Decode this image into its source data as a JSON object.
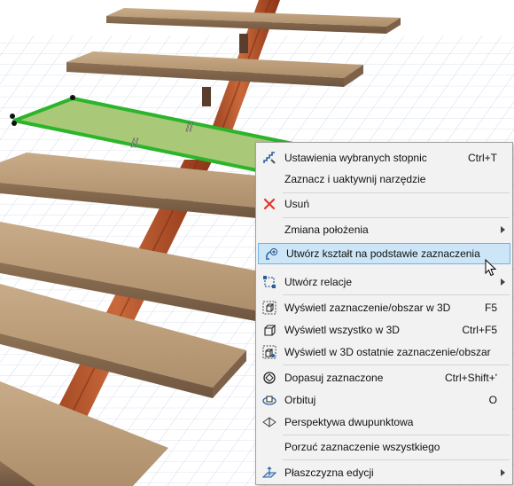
{
  "scene": {
    "description_icon": "3d-stair-scene",
    "colors": {
      "tread": "#b99a77",
      "tread_selected": "#a9c878",
      "selection_outline": "#2bb52b",
      "stringer": "#b5532a",
      "grid_line": "#c9d3e6"
    }
  },
  "context_menu": {
    "items": [
      {
        "label": "Ustawienia wybranych stopnic",
        "shortcut": "Ctrl+T",
        "icon": "stair-settings-icon"
      },
      {
        "label": "Zaznacz i uaktywnij narzędzie",
        "shortcut": "",
        "icon": ""
      },
      {
        "label": "Usuń",
        "shortcut": "",
        "icon": "delete-x-icon"
      },
      {
        "label": "Zmiana położenia",
        "shortcut": "",
        "icon": "",
        "submenu": true
      },
      {
        "label": "Utwórz kształt na podstawie zaznaczenia",
        "shortcut": "",
        "icon": "create-shape-icon",
        "highlighted": true
      },
      {
        "label": "Utwórz relacje",
        "shortcut": "",
        "icon": "create-relation-icon",
        "submenu": true
      },
      {
        "label": "Wyświetl zaznaczenie/obszar w 3D",
        "shortcut": "F5",
        "icon": "show-selection-3d-icon"
      },
      {
        "label": "Wyświetl wszystko w 3D",
        "shortcut": "Ctrl+F5",
        "icon": "show-all-3d-icon"
      },
      {
        "label": "Wyświetl w 3D ostatnie zaznaczenie/obszar",
        "shortcut": "",
        "icon": "show-last-3d-icon"
      },
      {
        "label": "Dopasuj zaznaczone",
        "shortcut": "Ctrl+Shift+'",
        "icon": "fit-selected-icon"
      },
      {
        "label": "Orbituj",
        "shortcut": "O",
        "icon": "orbit-icon"
      },
      {
        "label": "Perspektywa dwupunktowa",
        "shortcut": "",
        "icon": "two-point-perspective-icon"
      },
      {
        "label": "Porzuć zaznaczenie wszystkiego",
        "shortcut": "",
        "icon": ""
      },
      {
        "label": "Płaszczyzna edycji",
        "shortcut": "",
        "icon": "editing-plane-icon",
        "submenu": true
      }
    ]
  }
}
